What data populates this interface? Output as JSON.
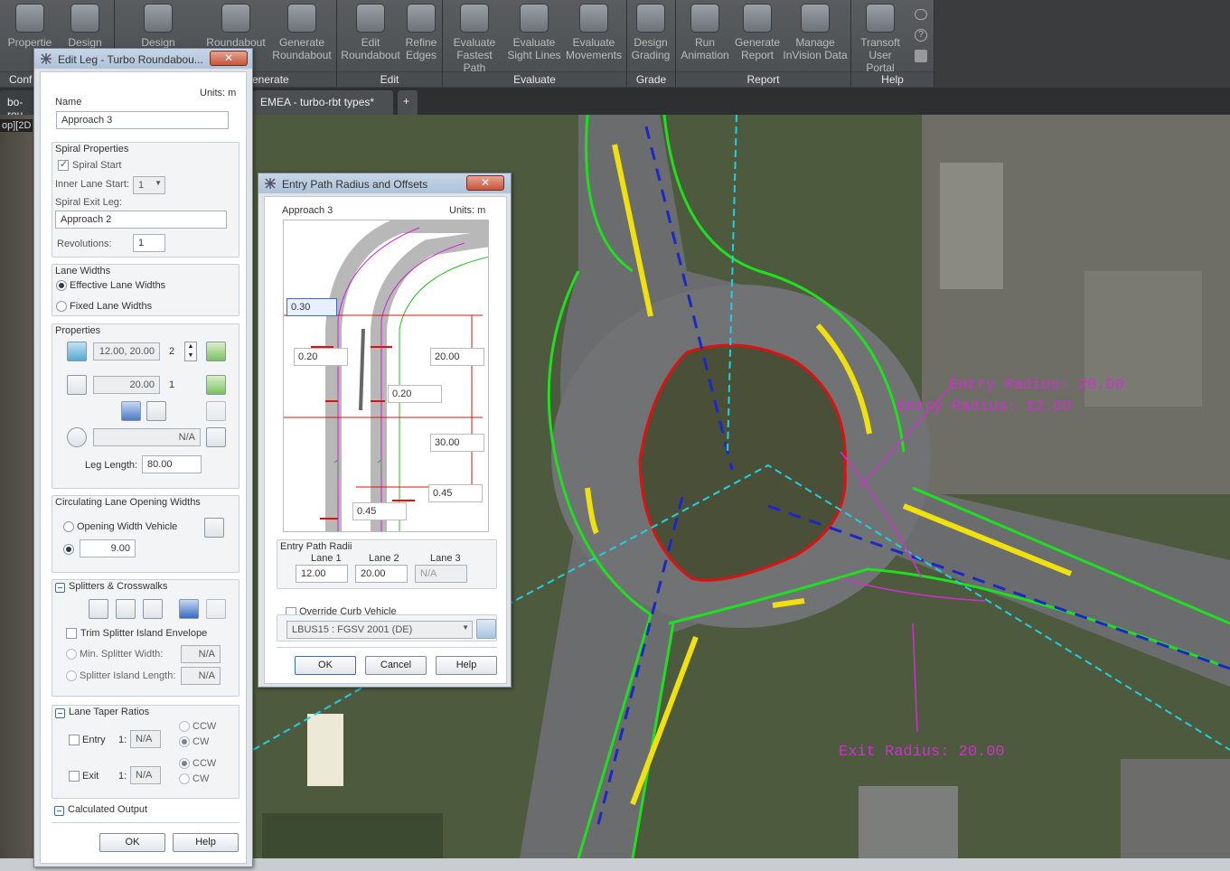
{
  "ribbon": {
    "buttons": [
      {
        "l1": "Propertie",
        "l2": "",
        "icon": "palette-icon"
      },
      {
        "l1": "Design",
        "l2": "",
        "icon": "printer-icon"
      },
      {
        "l1": "Design",
        "l2": "",
        "icon": "design-icon"
      },
      {
        "l1": "Roundabout",
        "l2": "",
        "icon": "roundabout-icon"
      },
      {
        "l1": "Generate",
        "l2": "Roundabout",
        "icon": "generate-icon"
      },
      {
        "l1": "Edit",
        "l2": "Roundabout",
        "icon": "edit-icon"
      },
      {
        "l1": "Refine",
        "l2": "Edges",
        "icon": "refine-icon"
      },
      {
        "l1": "Evaluate",
        "l2": "Fastest Path",
        "icon": "gauge-icon"
      },
      {
        "l1": "Evaluate",
        "l2": "Sight Lines",
        "icon": "sight-icon"
      },
      {
        "l1": "Evaluate",
        "l2": "Movements",
        "icon": "truck-icon"
      },
      {
        "l1": "Design",
        "l2": "Grading",
        "icon": "grading-icon"
      },
      {
        "l1": "Run",
        "l2": "Animation",
        "icon": "film-icon"
      },
      {
        "l1": "Generate",
        "l2": "Report",
        "icon": "report-icon"
      },
      {
        "l1": "Manage",
        "l2": "InVision Data",
        "icon": "invision-icon"
      },
      {
        "l1": "Transoft",
        "l2": "User Portal",
        "icon": "portal-icon"
      }
    ],
    "groups": [
      "Conf",
      "enerate",
      "Edit",
      "Evaluate",
      "Grade",
      "Report",
      "Help"
    ]
  },
  "tabs": {
    "left": "bo-rou",
    "active": "EMEA - turbo-rbt types*",
    "add": "+",
    "view_label": "op][2D"
  },
  "map": {
    "entry_radius_1": "Entry Radius: 20.00",
    "entry_radius_2": "Entry Radius: 12.00",
    "exit_radius": "Exit Radius: 20.00"
  },
  "edit_leg": {
    "title": "Edit Leg - Turbo Roundabou...",
    "close": "✕",
    "units": "Units: m",
    "name_label": "Name",
    "name_value": "Approach 3",
    "spiral_group": "Spiral Properties",
    "spiral_start": "Spiral Start",
    "inner_lane_start_label": "Inner Lane Start:",
    "inner_lane_start_value": "1",
    "spiral_exit_leg_label": "Spiral Exit Leg:",
    "spiral_exit_leg_value": "Approach 2",
    "revolutions_label": "Revolutions:",
    "revolutions_value": "1",
    "lane_widths_group": "Lane Widths",
    "effective_lane_widths": "Effective Lane Widths",
    "fixed_lane_widths": "Fixed Lane Widths",
    "properties_group": "Properties",
    "entry_widths": "12.00, 20.00",
    "entry_count": "2",
    "exit_width": "20.00",
    "exit_count": "1",
    "na_value": "N/A",
    "leg_length_label": "Leg Length:",
    "leg_length_value": "80.00",
    "circ_group": "Circulating Lane Opening Widths",
    "opening_width_vehicle": "Opening Width Vehicle",
    "opening_value": "9.00",
    "splitters_group": "Splitters & Crosswalks",
    "trim_splitter": "Trim Splitter Island Envelope",
    "min_splitter": "Min. Splitter Width:",
    "min_splitter_value": "N/A",
    "splitter_length": "Splitter Island Length:",
    "splitter_length_value": "N/A",
    "taper_group": "Lane Taper Ratios",
    "entry_label": "Entry",
    "exit_label": "Exit",
    "ratio_prefix": "1:",
    "ratio_value": "N/A",
    "ccw": "CCW",
    "cw": "CW",
    "calc_output": "Calculated Output",
    "ok": "OK",
    "help": "Help"
  },
  "entry_path": {
    "title": "Entry Path Radius and Offsets",
    "close": "✕",
    "approach": "Approach 3",
    "units": "Units: m",
    "offsets": [
      "0.30",
      "0.20",
      "0.20",
      "0.45",
      "0.45"
    ],
    "radius_labels": [
      "20.00",
      "30.00"
    ],
    "radii_group": "Entry Path Radii",
    "lane1_label": "Lane 1",
    "lane2_label": "Lane 2",
    "lane3_label": "Lane 3",
    "lane1_value": "12.00",
    "lane2_value": "20.00",
    "lane3_value": "N/A",
    "override_label": "Override Curb Vehicle",
    "vehicle_value": "LBUS15 : FGSV 2001 (DE)",
    "ok": "OK",
    "cancel": "Cancel",
    "help": "Help"
  },
  "colors": {
    "curb": "#1fe01f",
    "circle": "#e01010",
    "marking": "#f0e010",
    "lane": "#1a28c8",
    "radius": "#d030d0",
    "axis": "#20d0e0"
  }
}
